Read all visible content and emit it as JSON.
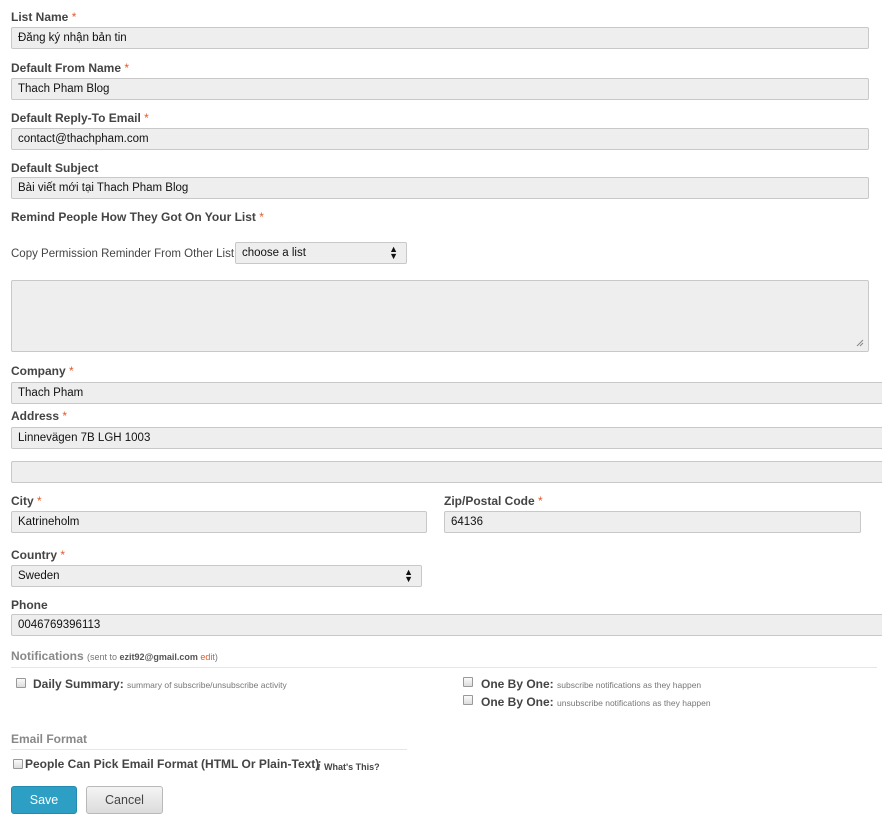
{
  "list_name": {
    "label": "List Name",
    "value": "Đăng ký nhận bản tin"
  },
  "from_name": {
    "label": "Default From Name",
    "value": "Thach Pham Blog"
  },
  "reply_to": {
    "label": "Default Reply-To Email",
    "value": "contact@thachpham.com"
  },
  "subject": {
    "label": "Default Subject",
    "value": "Bài viết mới tại Thach Pham Blog"
  },
  "remind": {
    "label": "Remind People How They Got On Your List",
    "copy_label": "Copy Permission Reminder From Other List",
    "copy_select": "choose a list",
    "text": ""
  },
  "company": {
    "label": "Company",
    "value": "Thach Pham"
  },
  "address": {
    "label": "Address",
    "line1": "Linnevägen 7B LGH 1003",
    "line2": ""
  },
  "city": {
    "label": "City",
    "value": "Katrineholm"
  },
  "zip": {
    "label": "Zip/Postal Code",
    "value": "64136"
  },
  "country": {
    "label": "Country",
    "value": "Sweden"
  },
  "phone": {
    "label": "Phone",
    "value": "0046769396113"
  },
  "required_mark": "*",
  "notifications": {
    "title": "Notifications",
    "sent_prefix": "(sent to",
    "email": "ezit92@gmail.com",
    "edit": "edit",
    "sent_suffix": ")",
    "daily": {
      "label": "Daily Summary:",
      "desc": "summary of subscribe/unsubscribe activity",
      "checked": false
    },
    "one_sub": {
      "label": "One By One:",
      "desc": "subscribe notifications as they happen",
      "checked": false
    },
    "one_unsub": {
      "label": "One By One:",
      "desc": "unsubscribe notifications as they happen",
      "checked": false
    }
  },
  "email_format": {
    "title": "Email Format",
    "pick_label": "People Can Pick Email Format (HTML Or Plain-Text)",
    "whats_this": "What's This?",
    "info_glyph": "i",
    "checked": false
  },
  "buttons": {
    "save": "Save",
    "cancel": "Cancel"
  },
  "colors": {
    "accent": "#2e9fc4",
    "required": "#e05a2b",
    "field_bg": "#eeeeee"
  }
}
